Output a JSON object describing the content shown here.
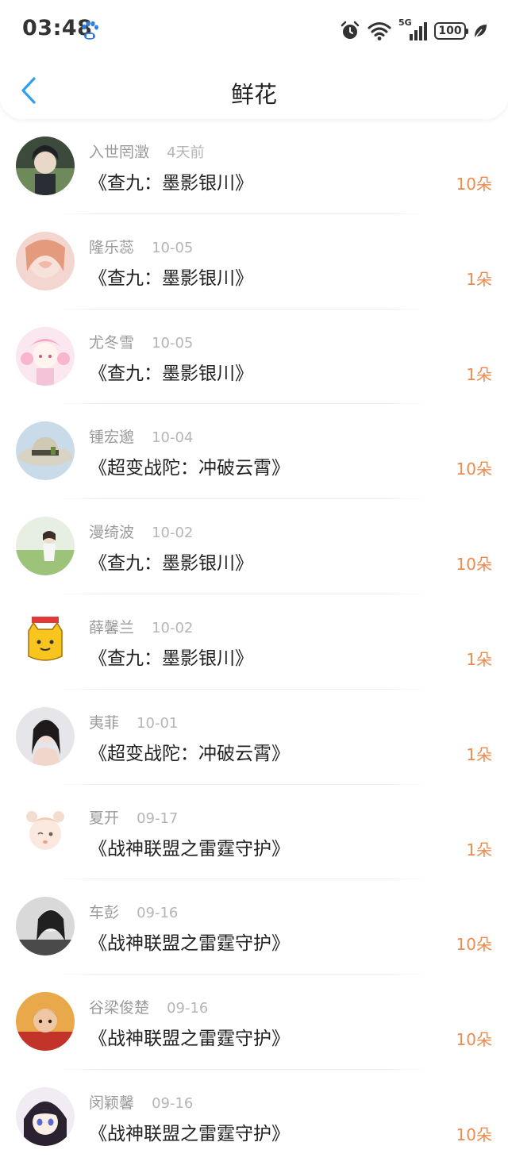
{
  "status_bar": {
    "time": "03:48",
    "network": "5G",
    "battery": "100"
  },
  "header": {
    "title": "鲜花"
  },
  "accent_color": "#ef8a4c",
  "back_color": "#2e9ff0",
  "items": [
    {
      "user": "入世罔澂",
      "date": "4天前",
      "book": "《查九：墨影银川》",
      "amount": "10朵"
    },
    {
      "user": "隆乐蕊",
      "date": "10-05",
      "book": "《查九：墨影银川》",
      "amount": "1朵"
    },
    {
      "user": "尤冬雪",
      "date": "10-05",
      "book": "《查九：墨影银川》",
      "amount": "1朵"
    },
    {
      "user": "锺宏邈",
      "date": "10-04",
      "book": "《超变战陀：冲破云霄》",
      "amount": "10朵"
    },
    {
      "user": "漫绮波",
      "date": "10-02",
      "book": "《查九：墨影银川》",
      "amount": "10朵"
    },
    {
      "user": "薛馨兰",
      "date": "10-02",
      "book": "《查九：墨影银川》",
      "amount": "1朵"
    },
    {
      "user": "夷菲",
      "date": "10-01",
      "book": "《超变战陀：冲破云霄》",
      "amount": "1朵"
    },
    {
      "user": "夏开",
      "date": "09-17",
      "book": "《战神联盟之雷霆守护》",
      "amount": "1朵"
    },
    {
      "user": "车彭",
      "date": "09-16",
      "book": "《战神联盟之雷霆守护》",
      "amount": "10朵"
    },
    {
      "user": "谷梁俊楚",
      "date": "09-16",
      "book": "《战神联盟之雷霆守护》",
      "amount": "10朵"
    },
    {
      "user": "闵颖馨",
      "date": "09-16",
      "book": "《战神联盟之雷霆守护》",
      "amount": "10朵"
    }
  ]
}
